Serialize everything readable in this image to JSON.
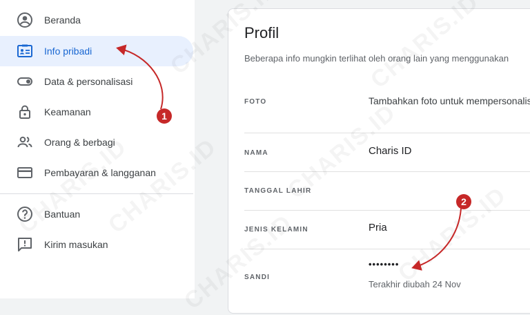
{
  "sidebar": {
    "items": [
      {
        "label": "Beranda",
        "icon": "account-circle-icon"
      },
      {
        "label": "Info pribadi",
        "icon": "id-card-icon",
        "active": true
      },
      {
        "label": "Data & personalisasi",
        "icon": "toggle-icon"
      },
      {
        "label": "Keamanan",
        "icon": "lock-icon"
      },
      {
        "label": "Orang & berbagi",
        "icon": "people-icon"
      },
      {
        "label": "Pembayaran & langganan",
        "icon": "credit-card-icon"
      }
    ],
    "secondary": [
      {
        "label": "Bantuan",
        "icon": "help-icon"
      },
      {
        "label": "Kirim masukan",
        "icon": "feedback-icon"
      }
    ]
  },
  "profile": {
    "title": "Profil",
    "subtitle": "Beberapa info mungkin terlihat oleh orang lain yang menggunakan",
    "rows": [
      {
        "label": "FOTO",
        "value": "Tambahkan foto untuk mempersonalisasi"
      },
      {
        "label": "NAMA",
        "value": "Charis ID"
      },
      {
        "label": "TANGGAL LAHIR",
        "value": ""
      },
      {
        "label": "JENIS KELAMIN",
        "value": "Pria"
      },
      {
        "label": "SANDI",
        "value": "••••••••",
        "note": "Terakhir diubah 24 Nov"
      }
    ]
  },
  "annotations": {
    "step1": "1",
    "step2": "2"
  },
  "watermark": "CHARIS.ID",
  "colors": {
    "accent": "#1967d2",
    "active_bg": "#e8f0fe",
    "annotation": "#c62828"
  }
}
